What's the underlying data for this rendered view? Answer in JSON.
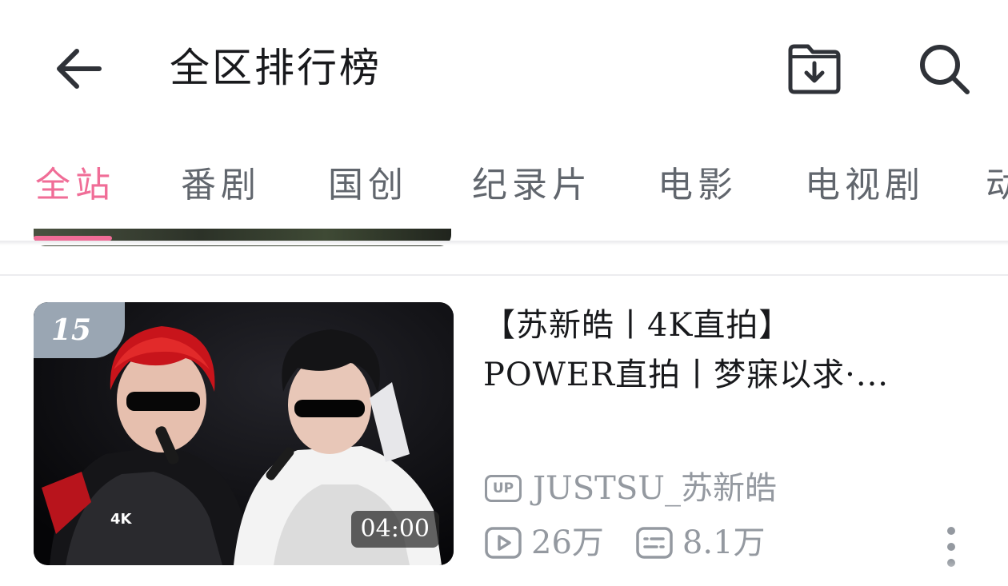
{
  "header": {
    "title": "全区排行榜"
  },
  "tabs": [
    {
      "label": "全站",
      "active": true
    },
    {
      "label": "番剧"
    },
    {
      "label": "国创"
    },
    {
      "label": "纪录片"
    },
    {
      "label": "电影"
    },
    {
      "label": "电视剧"
    },
    {
      "label": "动"
    }
  ],
  "video": {
    "rank": "15",
    "duration": "04:00",
    "title_line1": "【苏新皓丨4K直拍】",
    "title_line2": "POWER直拍丨梦寐以求·...",
    "up_badge": "UP",
    "uploader": "JUSTSU_苏新皓",
    "views": "26万",
    "danmaku": "8.1万",
    "thumb_watermark": "4K"
  },
  "colors": {
    "accent": "#f06d97",
    "text": "#18191c",
    "secondary": "#9499a0",
    "rank_badge": "#9aa6b3"
  },
  "icons": [
    "back-arrow-icon",
    "download-folder-icon",
    "search-icon",
    "play-count-icon",
    "danmaku-icon",
    "more-vertical-icon"
  ]
}
